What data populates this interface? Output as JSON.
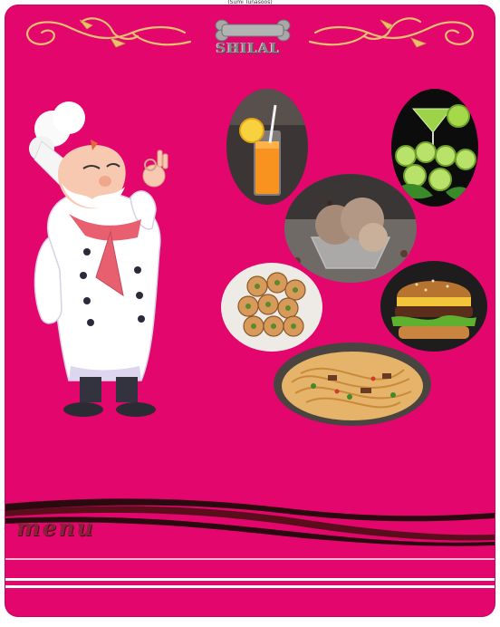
{
  "caption": "(Sumi Tunasoos)",
  "brand": {
    "name": "SHILAL"
  },
  "title": "menu",
  "colors": {
    "background": "#e2066d",
    "accent": "#8c1f3a",
    "ornament": "#e8c070"
  },
  "illustrations": [
    "chef-mascot",
    "orange-juice-photo",
    "lime-cocktail-photo",
    "ice-cream-photo",
    "pinwheel-pastry-photo",
    "burger-photo",
    "noodles-photo"
  ]
}
